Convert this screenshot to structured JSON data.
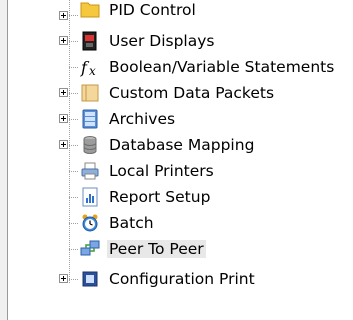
{
  "tree": {
    "items": [
      {
        "label": "PID Control",
        "icon": "folder-icon",
        "has_expander": true
      },
      {
        "label": "User Displays",
        "icon": "display-icon",
        "has_expander": true
      },
      {
        "label": "Boolean/Variable Statements",
        "icon": "function-fx-icon",
        "has_expander": false
      },
      {
        "label": "Custom Data Packets",
        "icon": "packet-folder-icon",
        "has_expander": true
      },
      {
        "label": "Archives",
        "icon": "archive-icon",
        "has_expander": true
      },
      {
        "label": "Database Mapping",
        "icon": "database-icon",
        "has_expander": true
      },
      {
        "label": "Local Printers",
        "icon": "printer-icon",
        "has_expander": false
      },
      {
        "label": "Report Setup",
        "icon": "report-chart-icon",
        "has_expander": false
      },
      {
        "label": "Batch",
        "icon": "batch-clock-icon",
        "has_expander": false
      },
      {
        "label": "Peer To Peer",
        "icon": "peer-network-icon",
        "has_expander": false
      },
      {
        "label": "Configuration Print",
        "icon": "config-print-icon",
        "has_expander": true
      }
    ]
  },
  "colors": {
    "background": "#ffffff",
    "panel_border": "#9a9a9a",
    "tree_lines": "#a0a0a0"
  }
}
